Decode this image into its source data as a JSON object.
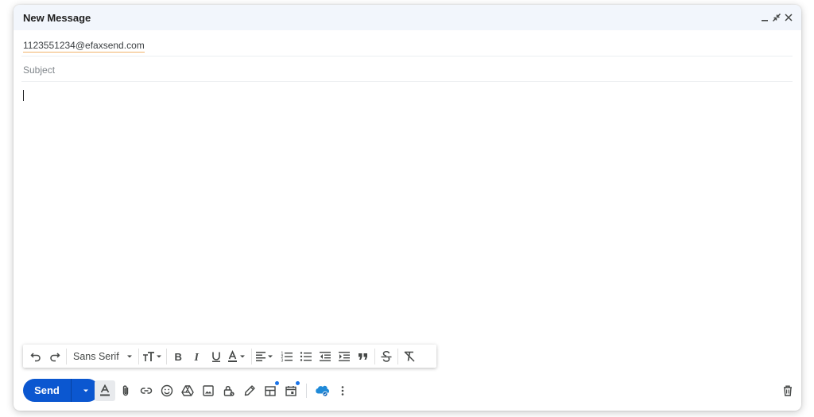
{
  "window": {
    "title": "New Message",
    "controls": [
      "minimize-icon",
      "pop-out-icon",
      "close-icon"
    ]
  },
  "recipient": {
    "value": "1123551234@efaxsend.com"
  },
  "subject": {
    "placeholder": "Subject",
    "value": ""
  },
  "body": {
    "value": ""
  },
  "format_toolbar": {
    "font_family": "Sans Serif",
    "tools": [
      "undo-icon",
      "redo-icon",
      "font-select",
      "text-size-icon",
      "bold-icon",
      "italic-icon",
      "underline-icon",
      "text-color-icon",
      "align-icon",
      "numbered-list-icon",
      "bulleted-list-icon",
      "indent-less-icon",
      "indent-more-icon",
      "quote-icon",
      "strikethrough-icon",
      "remove-formatting-icon"
    ]
  },
  "bottom_toolbar": {
    "send_label": "Send",
    "tools": [
      "formatting-options-icon",
      "attach-icon",
      "link-icon",
      "emoji-icon",
      "drive-icon",
      "photo-icon",
      "confidential-mode-icon",
      "signature-icon",
      "layouts-icon",
      "schedule-icon",
      "addon-icon",
      "more-options-icon",
      "discard-icon"
    ]
  },
  "colors": {
    "accent": "#0b57d0",
    "header_bg": "#f2f6fc",
    "recipient_underline": "#f2b36b",
    "new_feature_dot": "#1a73e8"
  }
}
